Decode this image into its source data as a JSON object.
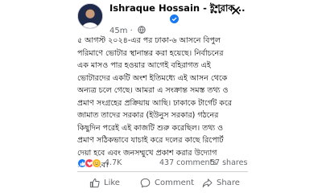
{
  "post": {
    "author_name": "Ishraque Hossain - ইশরাক...",
    "time": "45m",
    "menu_icon": "more-icon",
    "close_icon": "close-icon",
    "text": "৫ আগস্ট ২০২৪-এর পর ঢাকা-৬ আসনে বিপুল\nপরিমাণে ভোটার স্থানান্তর করা হয়েছে। নির্বাচনের\nএক মাসও পার হওয়ার আগেই বহিরাগত এই\nভোটারদের একটি অংশ ইতিমধ্যে এই আসন থেকে\nঅন্যত্র চলে গেছে। আমরা এ সংক্রান্ত সমস্ত তথ্য ও\nপ্রমাণ সংগ্রহের প্রক্রিয়ায় আছি। ঢাকাকে টার্গেট করে\nজামাত তাদের সরকার (ইউনুস সরকার) গঠনের\nকিছুদিন পরেই এই কাজটি শুরু করেছিল। তথ্য ও\nপ্রমাণ সঠিকভাবে যাচাই করে দলের কাছে রিপোর্ট\nদেয়া হবে এবং জনসম্মুখে প্রকাশ করার উদ্যোগ\nনেয়া হবে।"
  },
  "stats": {
    "reaction_count": "4.7K",
    "comments": "437 comments",
    "shares": "57 shares"
  },
  "actions": {
    "like": "Like",
    "comment": "Comment",
    "share": "Share"
  },
  "colors": {
    "like_blue": "#1877f2",
    "secondary_text": "#65676b",
    "divider": "#ced0d4"
  }
}
